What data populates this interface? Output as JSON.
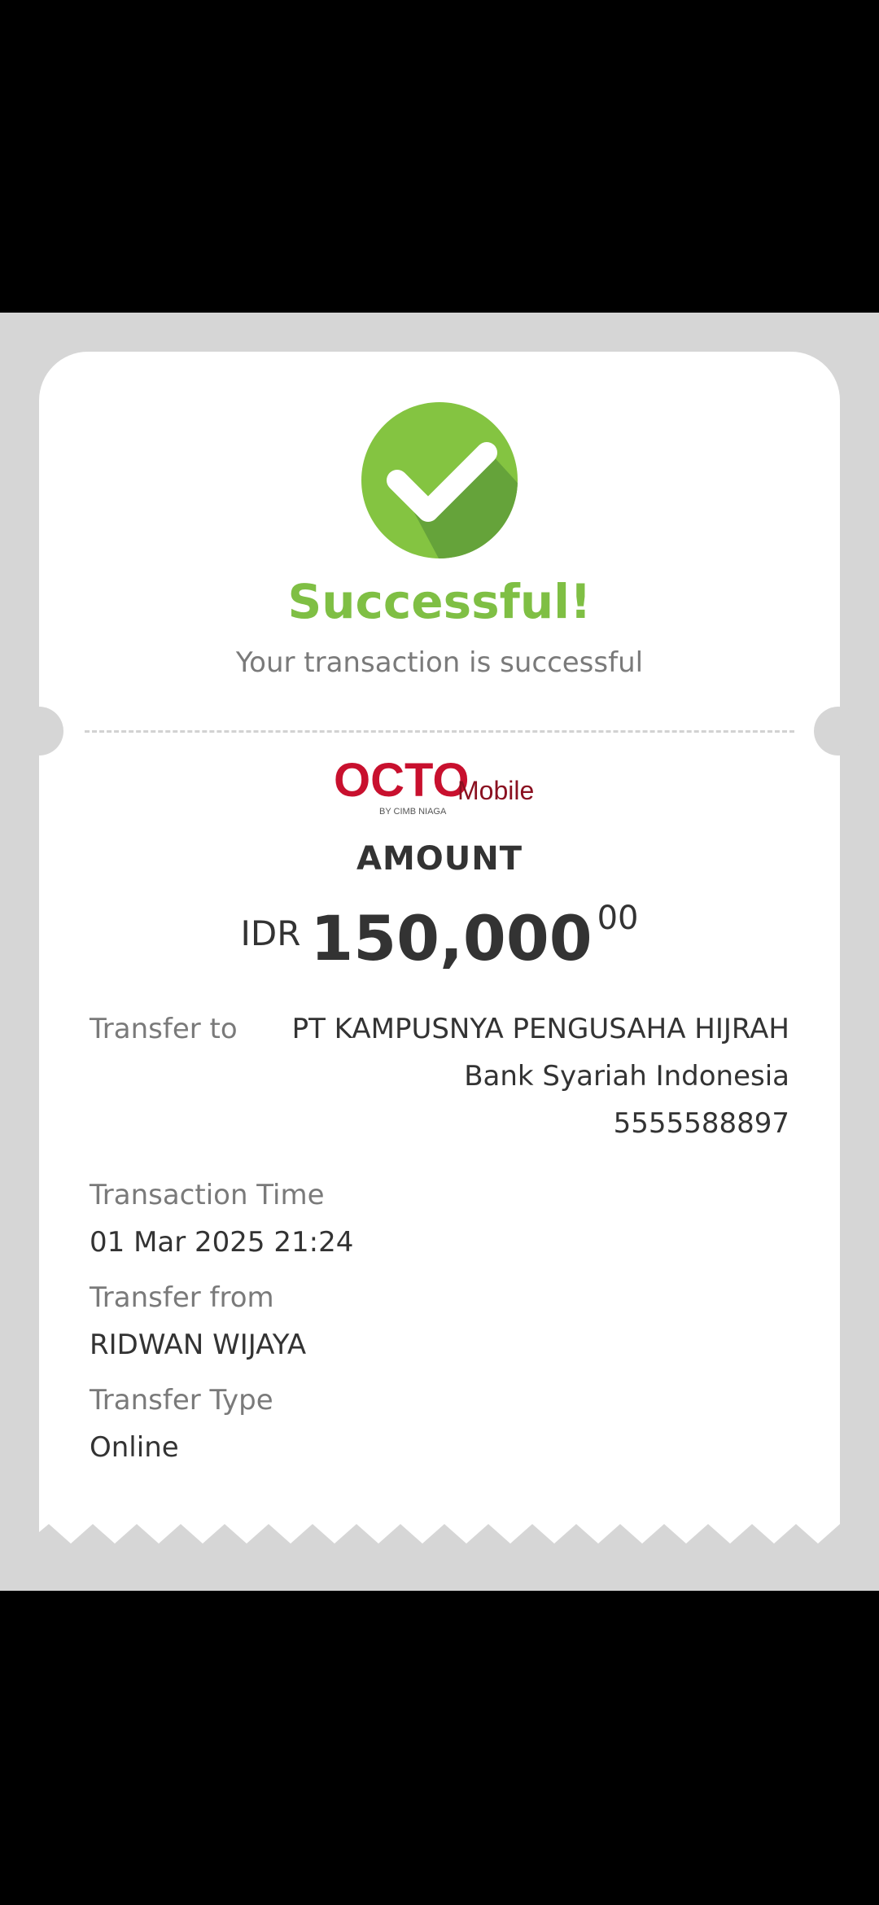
{
  "status": {
    "title": "Successful!",
    "subtitle": "Your transaction is successful"
  },
  "brand": {
    "logo_main": "OCTO",
    "logo_suffix": "Mobile",
    "logo_tagline": "BY CIMB NIAGA",
    "primary_color": "#c8102e",
    "success_color": "#7fbf44"
  },
  "amount": {
    "label": "AMOUNT",
    "currency": "IDR",
    "whole": "150,000",
    "decimal": "00"
  },
  "transfer_to": {
    "label": "Transfer to",
    "name": "PT KAMPUSNYA PENGUSAHA HIJRAH",
    "bank": "Bank Syariah Indonesia",
    "account": "5555588897"
  },
  "details": {
    "time_label": "Transaction Time",
    "time_value": "01 Mar 2025 21:24",
    "from_label": "Transfer from",
    "from_value": "RIDWAN WIJAYA",
    "type_label": "Transfer Type",
    "type_value": "Online"
  },
  "icons": {
    "status_icon": "check-circle-icon"
  }
}
